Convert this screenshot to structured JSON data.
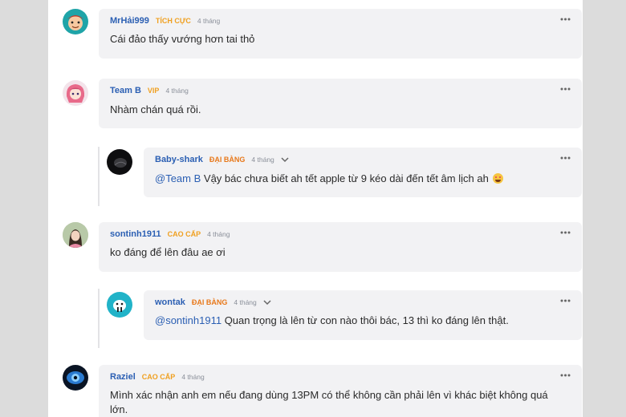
{
  "colors": {
    "username": "#2b5fb3",
    "badge_tich_cuc": "#f0a020",
    "badge_vip": "#f0a020",
    "badge_dai_bang": "#e8781a",
    "badge_cao_cap": "#f0a020",
    "bubble_bg": "#f2f2f4",
    "time": "#8a8f99"
  },
  "comments": [
    {
      "username": "MrHải999",
      "badge": "TÍCH CỰC",
      "time": "4 tháng",
      "text": "Cái đảo thấy vướng hơn tai thỏ",
      "avatar_icon": "cartoon-avatar-icon"
    },
    {
      "username": "Team B",
      "badge": "VIP",
      "time": "4 tháng",
      "text": "Nhàm chán quá rồi.",
      "avatar_icon": "anime-avatar-icon",
      "reply": {
        "username": "Baby-shark",
        "badge": "ĐẠI BÀNG",
        "time": "4 tháng",
        "mention": "@Team B",
        "text": " Vậy bác chưa biết ah tết apple từ 9 kéo dài đến tết âm lịch ah",
        "emoji": "heart-eyes-emoji-icon",
        "avatar_icon": "dark-avatar-icon"
      }
    },
    {
      "username": "sontinh1911",
      "badge": "CAO CẤP",
      "time": "4 tháng",
      "text": "ko đáng để lên đâu ae ơi",
      "avatar_icon": "photo-avatar-icon",
      "reply": {
        "username": "wontak",
        "badge": "ĐẠI BÀNG",
        "time": "4 tháng",
        "mention": "@sontinh1911",
        "text": " Quan trọng là lên từ con nào thôi bác, 13 thì ko đáng lên thật.",
        "avatar_icon": "walrus-avatar-icon"
      }
    },
    {
      "username": "Raziel",
      "badge": "CAO CẤP",
      "time": "4 tháng",
      "text_line1": "Mình xác nhận anh em nếu đang dùng 13PM có thể không cần phải lên vì khác biệt không quá",
      "text_line2": "lớn.",
      "avatar_icon": "eye-avatar-icon"
    }
  ]
}
